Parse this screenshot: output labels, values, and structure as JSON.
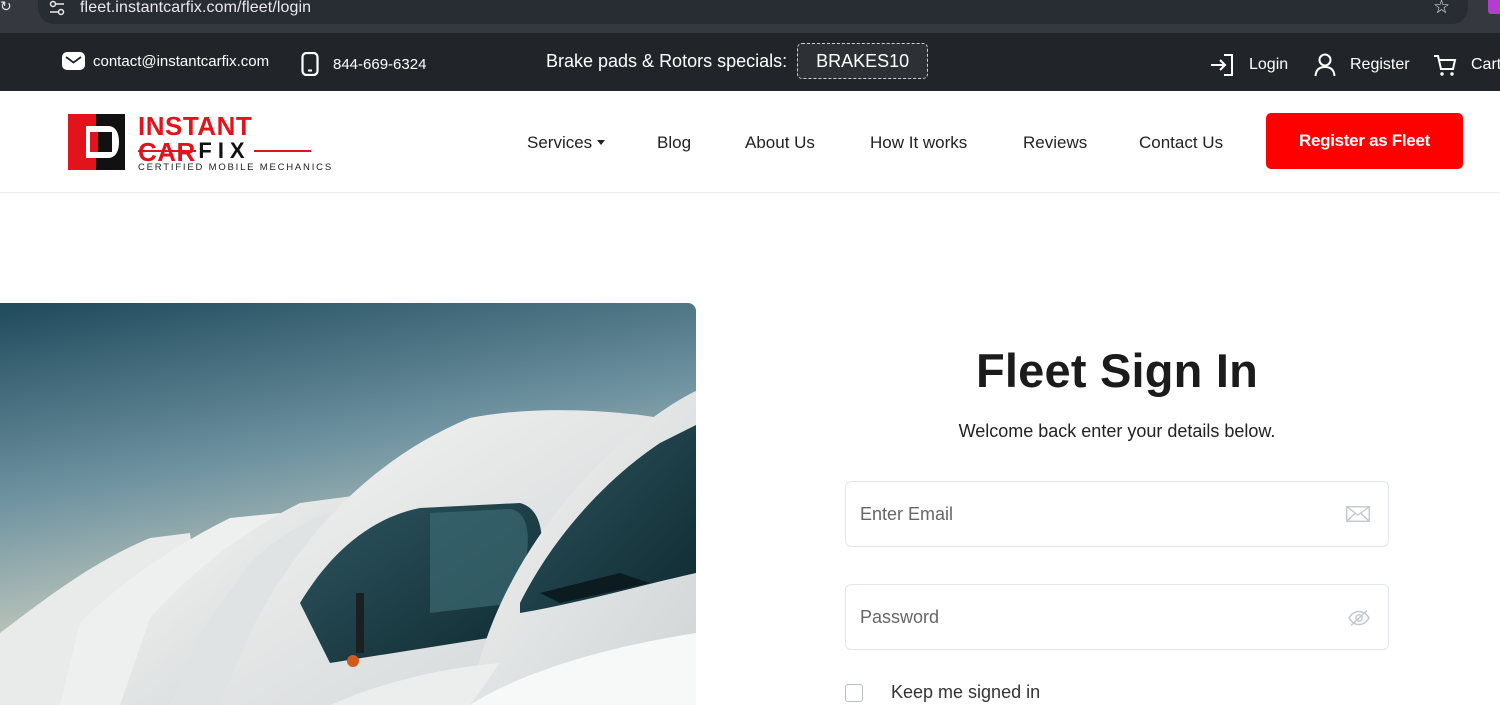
{
  "browser": {
    "url": "fleet.instantcarfix.com/fleet/login"
  },
  "topbar": {
    "email": "contact@instantcarfix.com",
    "phone": "844-669-6324",
    "promo_label": "Brake pads & Rotors specials:",
    "promo_code": "BRAKES10",
    "login_label": "Login",
    "register_label": "Register",
    "cart_label": "Cart"
  },
  "logo": {
    "title": "INSTANT CAR",
    "fix": "FIX",
    "tagline": "CERTIFIED MOBILE MECHANICS",
    "brand_color": "#e3131b"
  },
  "nav": {
    "items": [
      {
        "label": "Services",
        "has_dropdown": true
      },
      {
        "label": "Blog"
      },
      {
        "label": "About Us"
      },
      {
        "label": "How It works"
      },
      {
        "label": "Reviews"
      },
      {
        "label": "Contact Us"
      }
    ],
    "cta_label": "Register as Fleet",
    "cta_color": "#ff0000"
  },
  "signin": {
    "title": "Fleet Sign In",
    "subtitle": "Welcome back enter your details below.",
    "email_placeholder": "Enter Email",
    "email_icon": "envelope-icon",
    "password_placeholder": "Password",
    "password_icon": "eye-slash-icon",
    "remember_label": "Keep me signed in"
  }
}
